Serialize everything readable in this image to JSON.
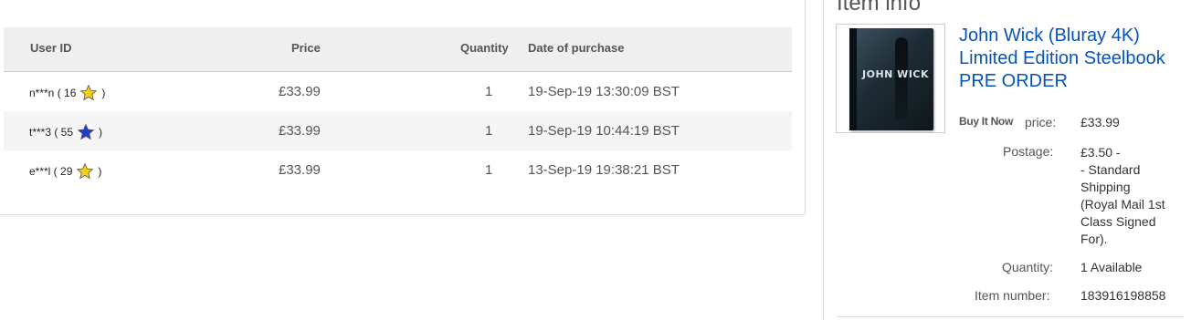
{
  "table": {
    "headers": {
      "user": "User ID",
      "price": "Price",
      "quantity": "Quantity",
      "date": "Date of purchase"
    },
    "rows": [
      {
        "user": "n***n ( 16",
        "close": ")",
        "star_color": "#f4d118",
        "price": "£33.99",
        "quantity": "1",
        "date": "19-Sep-19 13:30:09 BST"
      },
      {
        "user": "t***3 ( 55",
        "close": ")",
        "star_color": "#1a3fd0",
        "price": "£33.99",
        "quantity": "1",
        "date": "19-Sep-19 10:44:19 BST"
      },
      {
        "user": "e***l ( 29",
        "close": ")",
        "star_color": "#f4d118",
        "price": "£33.99",
        "quantity": "1",
        "date": "13-Sep-19 19:38:21 BST"
      }
    ]
  },
  "item_info": {
    "heading": "Item info",
    "title": "John Wick (Bluray 4K) Limited Edition Steelbook PRE ORDER",
    "thumbnail_text": "JOHN WICK",
    "buy_it_now": "Buy It Now",
    "price_label": "price:",
    "price_value": "£33.99",
    "postage_label": "Postage:",
    "postage_lines": [
      "£3.50 -",
      "- Standard",
      "Shipping",
      "(Royal Mail 1st",
      "Class Signed",
      "For)."
    ],
    "quantity_label": "Quantity:",
    "quantity_value": "1 Available",
    "item_number_label": "Item number:",
    "item_number_value": "183916198858"
  },
  "colors": {
    "link": "#0654ba",
    "star_yellow": "#f4d118",
    "star_blue": "#1a3fd0"
  }
}
